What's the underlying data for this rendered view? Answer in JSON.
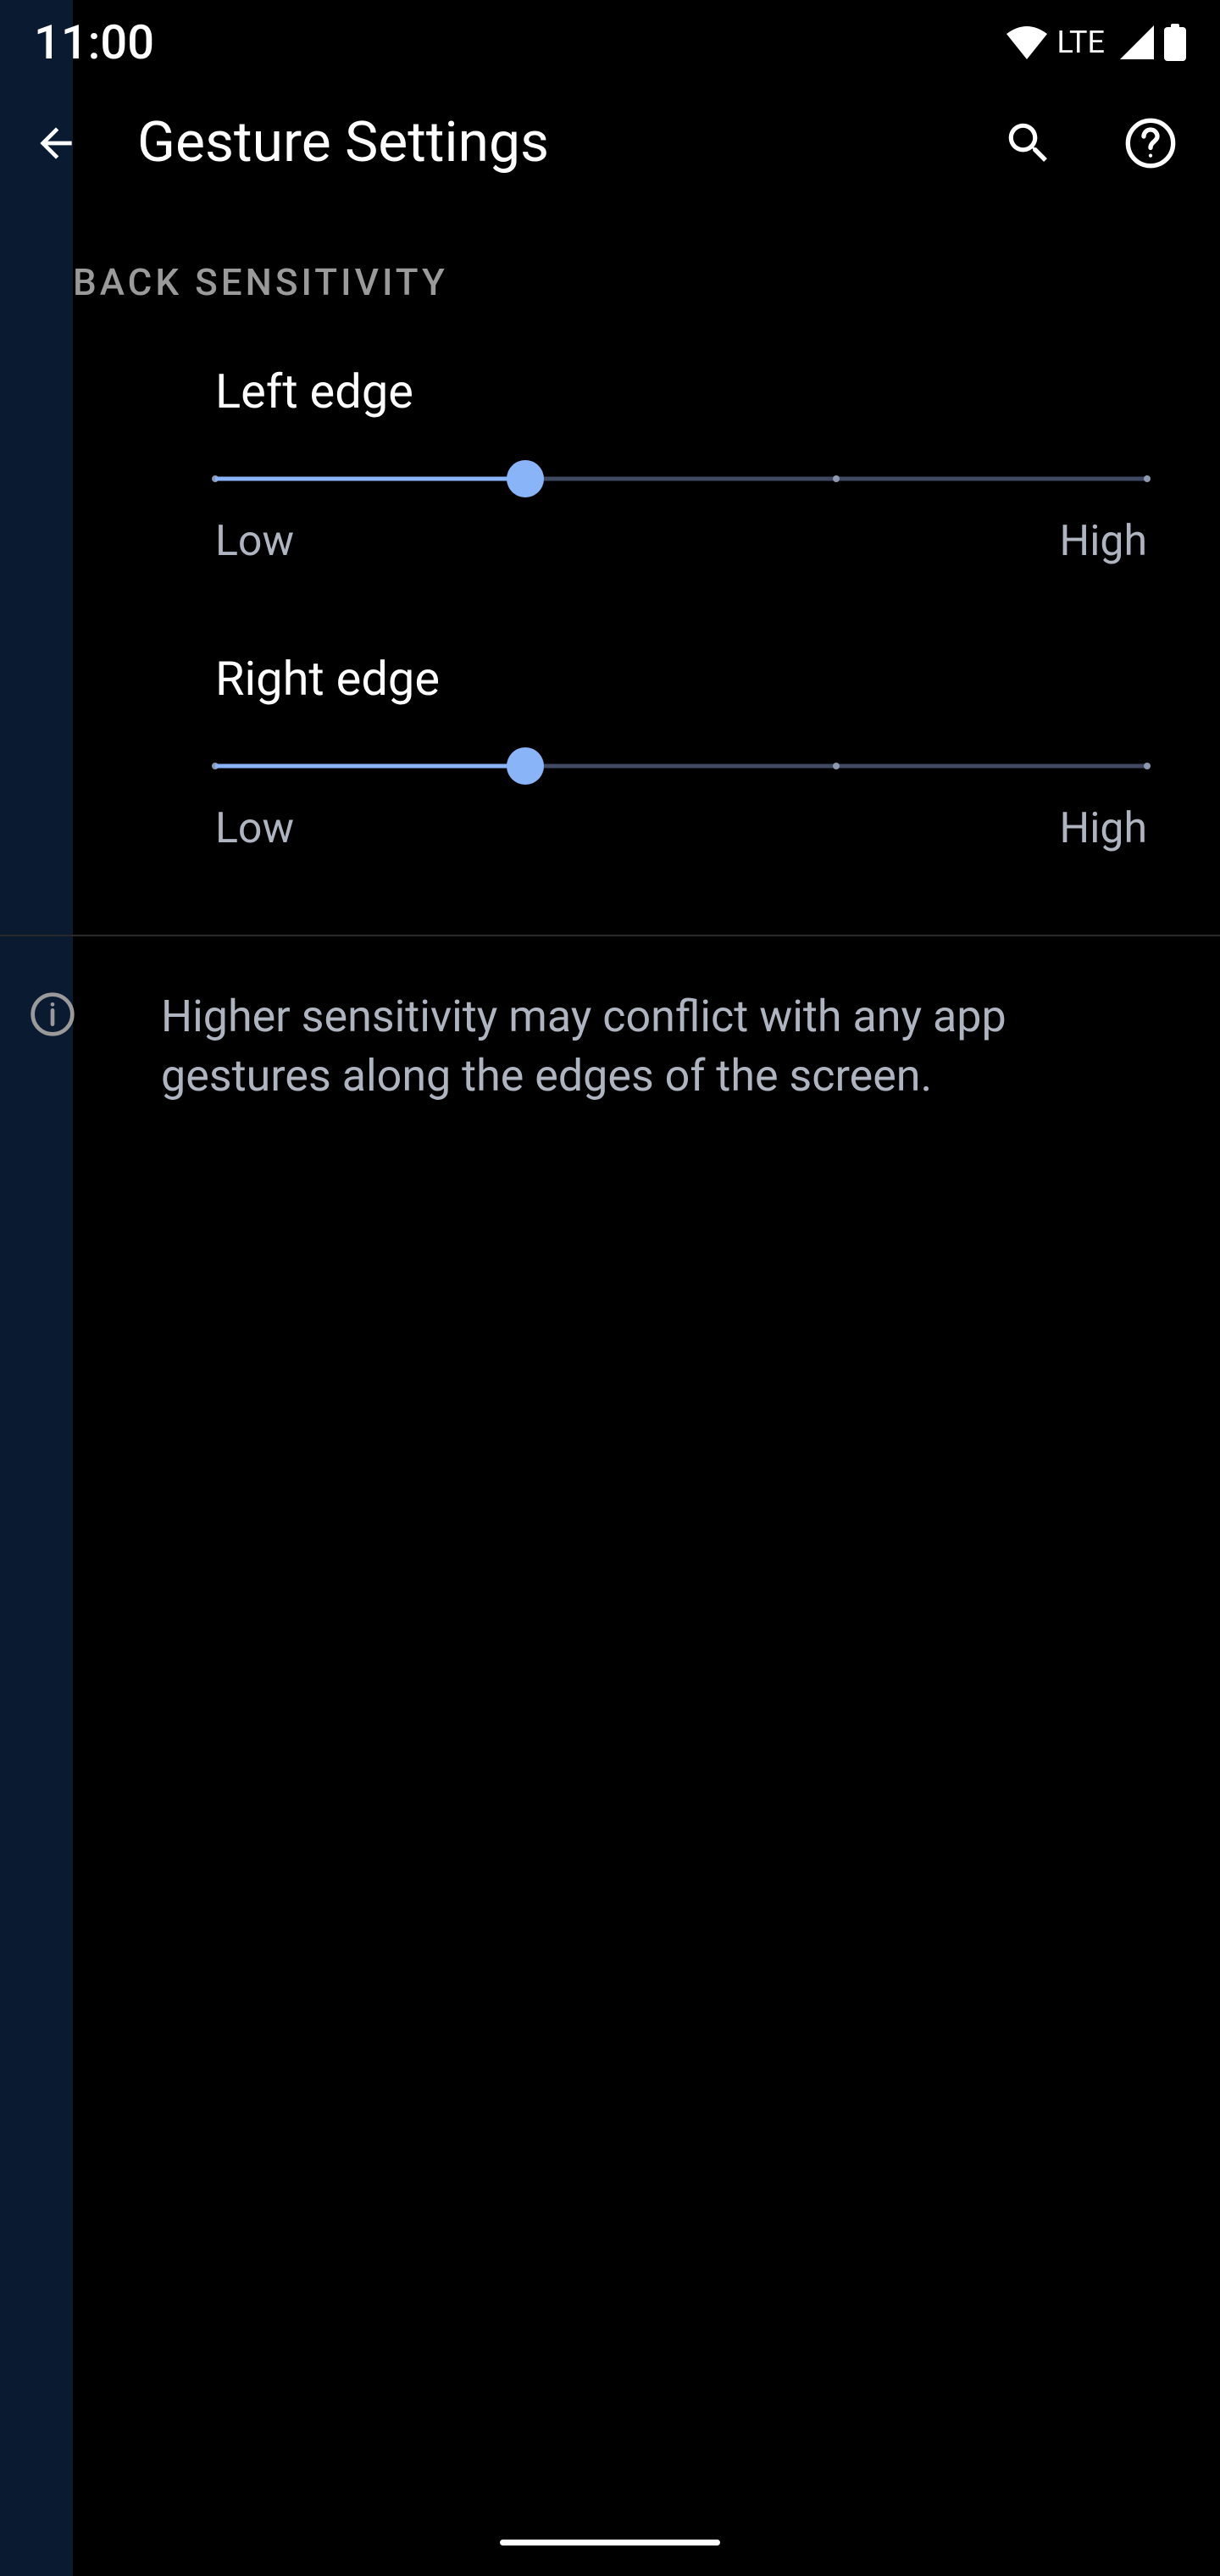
{
  "status_bar": {
    "time": "11:00",
    "lte": "LTE"
  },
  "header": {
    "title": "Gesture Settings"
  },
  "section": {
    "title": "BACK SENSITIVITY"
  },
  "sliders": {
    "left": {
      "label": "Left edge",
      "low": "Low",
      "high": "High",
      "value": 33.3
    },
    "right": {
      "label": "Right edge",
      "low": "Low",
      "high": "High",
      "value": 33.3
    }
  },
  "info": {
    "text": "Higher sensitivity may conflict with any app gestures along the edges of the screen."
  }
}
